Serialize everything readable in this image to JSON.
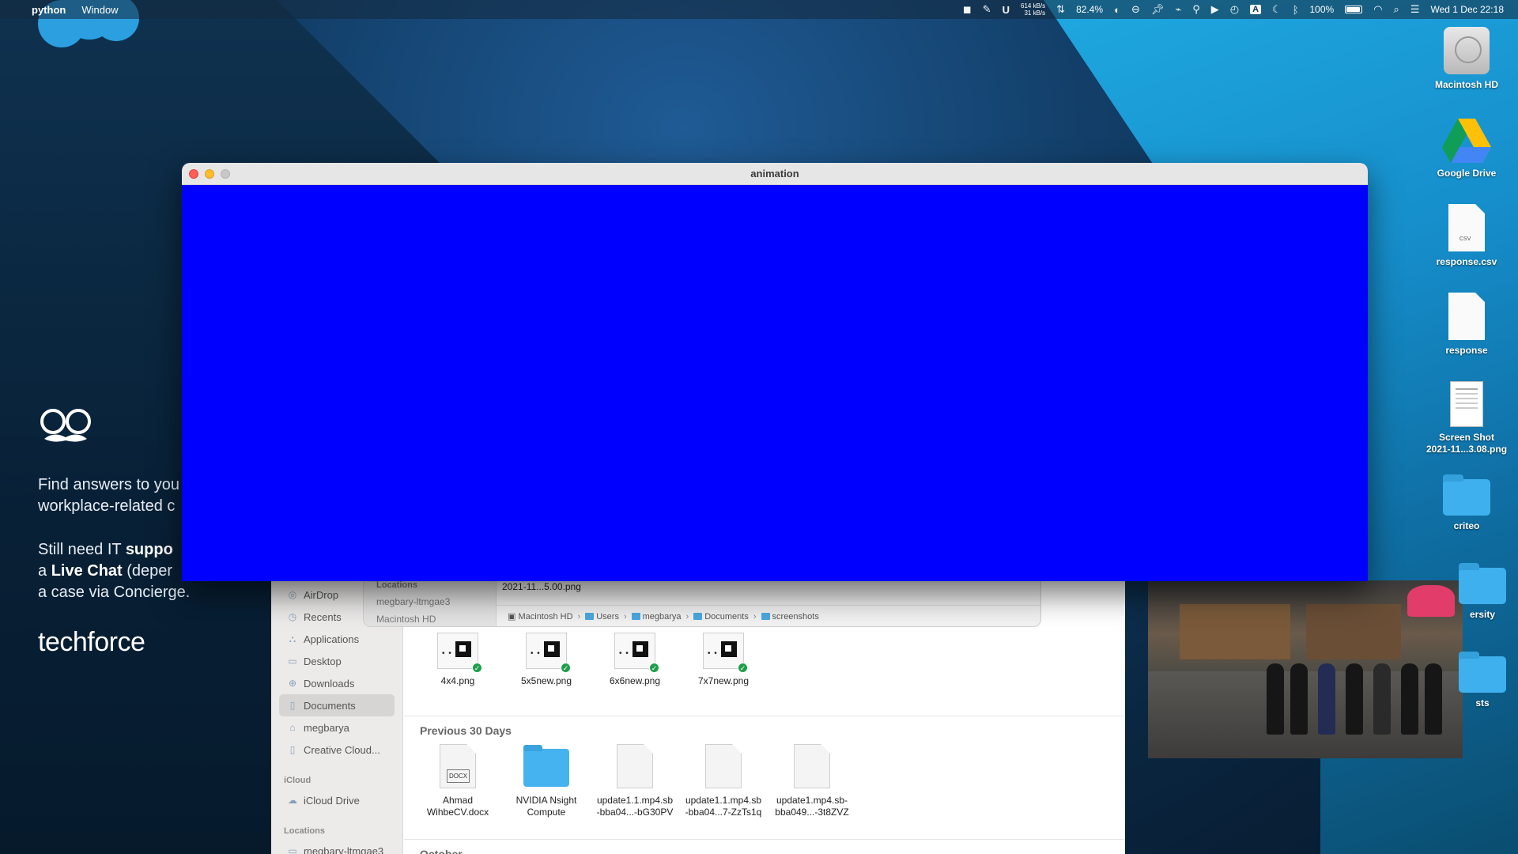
{
  "menubar": {
    "app_name": "python",
    "menu_window": "Window",
    "net_up": "614 kB/s",
    "net_down": "31 kB/s",
    "cpu": "82.4%",
    "battery": "100%",
    "clock": "Wed 1 Dec  22:18",
    "input_source": "A"
  },
  "techforce": {
    "line1": "Find answers to you",
    "line2": "workplace-related c",
    "still_prefix": "Still need IT ",
    "still_bold": "suppo",
    "live_prefix": "a ",
    "live_bold": "Live Chat",
    "live_suffix": " (deper",
    "case_line": "a case via Concierge.",
    "brand": "techforce"
  },
  "animation_window": {
    "title": "animation",
    "canvas_color": "#0000ff"
  },
  "dialog": {
    "locations_heading": "Locations",
    "location_item": "megbary-ltmgae3",
    "location_item2": "Macintosh HD",
    "file_name": "2021-11...5.00.png",
    "path": [
      "Macintosh HD",
      "Users",
      "megbarya",
      "Documents",
      "screenshots"
    ]
  },
  "finder": {
    "sidebar": {
      "items": [
        "AirDrop",
        "Recents",
        "Applications",
        "Desktop",
        "Downloads",
        "Documents",
        "megbarya",
        "Creative Cloud..."
      ],
      "icloud_heading": "iCloud",
      "icloud_items": [
        "iCloud Drive"
      ],
      "locations_heading": "Locations",
      "location_items": [
        "megbary-ltmgae3"
      ]
    },
    "recent_files": [
      "4x4.png",
      "5x5new.png",
      "6x6new.png",
      "7x7new.png"
    ],
    "section_previous": "Previous 30 Days",
    "previous_files": [
      {
        "line1": "Ahmad",
        "line2": "WihbeCV.docx"
      },
      {
        "line1": "NVIDIA Nsight",
        "line2": "Compute"
      },
      {
        "line1": "update1.1.mp4.sb",
        "line2": "-bba04...-bG30PV"
      },
      {
        "line1": "update1.1.mp4.sb",
        "line2": "-bba04...7-ZzTs1q"
      },
      {
        "line1": "update1.mp4.sb-",
        "line2": "bba049...-3t8ZVZ"
      }
    ],
    "docx_tag": "DOCX",
    "section_october": "October"
  },
  "desktop_icons": [
    {
      "label": "Macintosh HD"
    },
    {
      "label": "Google Drive"
    },
    {
      "label": "response.csv",
      "ext": "CSV"
    },
    {
      "label": "response"
    },
    {
      "line1": "Screen Shot",
      "line2": "2021-11...3.08.png"
    },
    {
      "label": "criteo"
    },
    {
      "label": "ersity"
    },
    {
      "label": "sts"
    }
  ]
}
